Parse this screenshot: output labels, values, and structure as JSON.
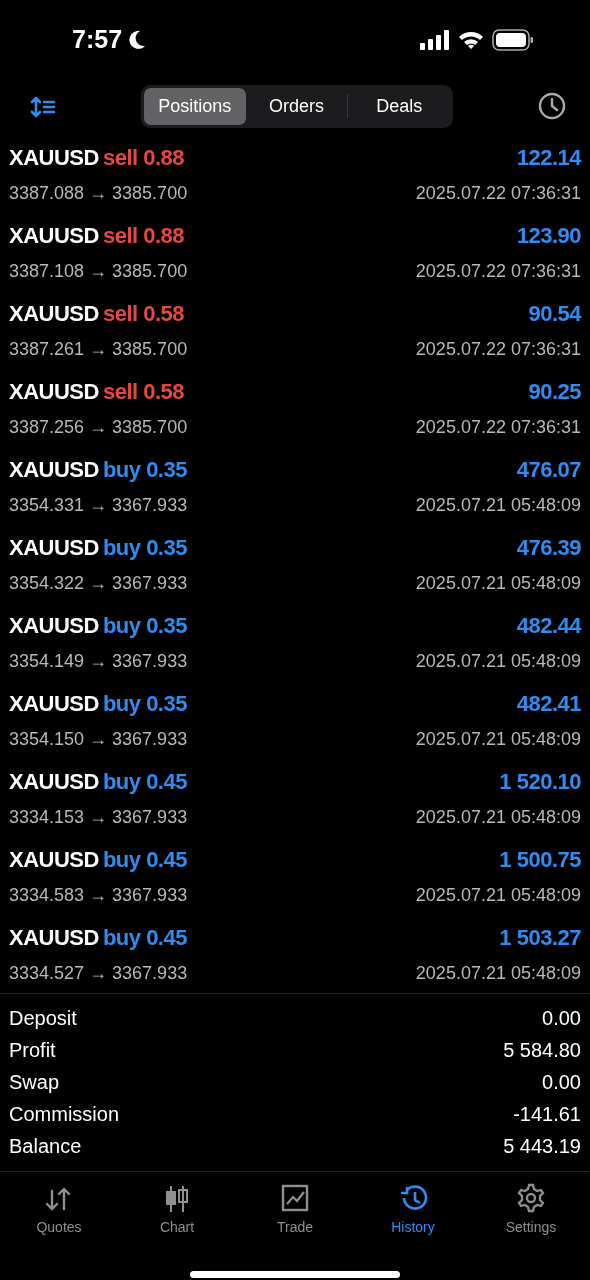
{
  "status_bar": {
    "time": "7:57"
  },
  "segments": [
    {
      "label": "Positions",
      "selected": true
    },
    {
      "label": "Orders",
      "selected": false
    },
    {
      "label": "Deals",
      "selected": false
    }
  ],
  "positions": [
    {
      "symbol": "XAUUSD",
      "kind": "sell",
      "side": "sell 0.88",
      "prices": "3387.088 → 3385.700",
      "profit": "122.14",
      "time": "2025.07.22 07:36:31"
    },
    {
      "symbol": "XAUUSD",
      "kind": "sell",
      "side": "sell 0.88",
      "prices": "3387.108 → 3385.700",
      "profit": "123.90",
      "time": "2025.07.22 07:36:31"
    },
    {
      "symbol": "XAUUSD",
      "kind": "sell",
      "side": "sell 0.58",
      "prices": "3387.261 → 3385.700",
      "profit": "90.54",
      "time": "2025.07.22 07:36:31"
    },
    {
      "symbol": "XAUUSD",
      "kind": "sell",
      "side": "sell 0.58",
      "prices": "3387.256 → 3385.700",
      "profit": "90.25",
      "time": "2025.07.22 07:36:31"
    },
    {
      "symbol": "XAUUSD",
      "kind": "buy",
      "side": "buy 0.35",
      "prices": "3354.331 → 3367.933",
      "profit": "476.07",
      "time": "2025.07.21 05:48:09"
    },
    {
      "symbol": "XAUUSD",
      "kind": "buy",
      "side": "buy 0.35",
      "prices": "3354.322 → 3367.933",
      "profit": "476.39",
      "time": "2025.07.21 05:48:09"
    },
    {
      "symbol": "XAUUSD",
      "kind": "buy",
      "side": "buy 0.35",
      "prices": "3354.149 → 3367.933",
      "profit": "482.44",
      "time": "2025.07.21 05:48:09"
    },
    {
      "symbol": "XAUUSD",
      "kind": "buy",
      "side": "buy 0.35",
      "prices": "3354.150 → 3367.933",
      "profit": "482.41",
      "time": "2025.07.21 05:48:09"
    },
    {
      "symbol": "XAUUSD",
      "kind": "buy",
      "side": "buy 0.45",
      "prices": "3334.153 → 3367.933",
      "profit": "1 520.10",
      "time": "2025.07.21 05:48:09"
    },
    {
      "symbol": "XAUUSD",
      "kind": "buy",
      "side": "buy 0.45",
      "prices": "3334.583 → 3367.933",
      "profit": "1 500.75",
      "time": "2025.07.21 05:48:09"
    },
    {
      "symbol": "XAUUSD",
      "kind": "buy",
      "side": "buy 0.45",
      "prices": "3334.527 → 3367.933",
      "profit": "1 503.27",
      "time": "2025.07.21 05:48:09"
    }
  ],
  "summary": [
    {
      "label": "Deposit",
      "value": "0.00"
    },
    {
      "label": "Profit",
      "value": "5 584.80"
    },
    {
      "label": "Swap",
      "value": "0.00"
    },
    {
      "label": "Commission",
      "value": "-141.61"
    },
    {
      "label": "Balance",
      "value": "5 443.19"
    }
  ],
  "tab_bar": [
    {
      "label": "Quotes",
      "kind": "quotes",
      "selected": false
    },
    {
      "label": "Chart",
      "kind": "chart",
      "selected": false
    },
    {
      "label": "Trade",
      "kind": "trade",
      "selected": false
    },
    {
      "label": "History",
      "kind": "history",
      "selected": true
    },
    {
      "label": "Settings",
      "kind": "settings",
      "selected": false
    }
  ]
}
